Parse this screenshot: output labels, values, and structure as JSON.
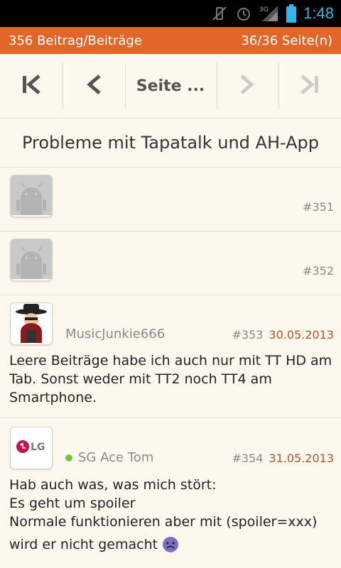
{
  "status": {
    "time": "1:48",
    "network": "3G"
  },
  "header": {
    "post_count": "356 Beitrag/Beiträge",
    "page_info": "36/36 Seite(n)"
  },
  "pager": {
    "page_label": "Seite ..."
  },
  "topic": {
    "title": "Probleme mit Tapatalk und AH-App"
  },
  "posts": [
    {
      "number": "#351"
    },
    {
      "number": "#352"
    },
    {
      "author": "MusicJunkie666",
      "number": "#353",
      "date": "30.05.2013",
      "lines": [
        "Leere Beiträge habe ich auch nur mit TT HD am",
        "Tab. Sonst weder mit TT2 noch TT4 am",
        "Smartphone."
      ]
    },
    {
      "author": "SG Ace Tom",
      "number": "#354",
      "date": "31.05.2013",
      "avatar_text": "LG",
      "lines": [
        "Hab auch was, was mich stört:",
        "Es geht um spoiler",
        "Normale funktionieren aber mit (spoiler=xxx)",
        "wird er nicht gemacht"
      ]
    }
  ],
  "colors": {
    "accent": "#e2652a",
    "date": "#b5532a",
    "online": "#7cc242",
    "status_blue": "#33b5e5"
  }
}
